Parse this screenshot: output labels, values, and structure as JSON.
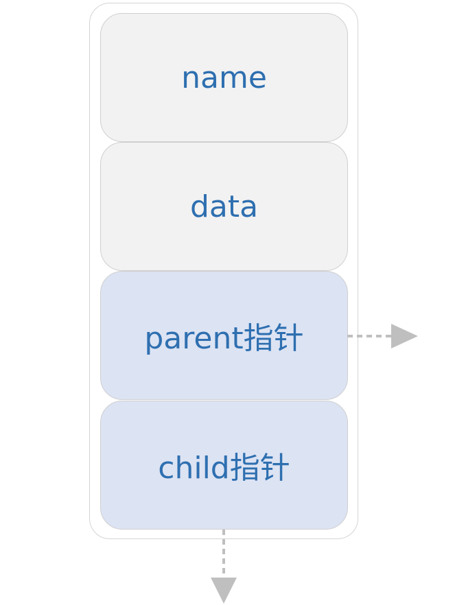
{
  "struct": {
    "fields": [
      {
        "id": "name",
        "label": "name",
        "style": "plain"
      },
      {
        "id": "data",
        "label": "data",
        "style": "plain"
      },
      {
        "id": "parent",
        "label": "parent指针",
        "style": "pointer"
      },
      {
        "id": "child",
        "label": "child指针",
        "style": "pointer"
      }
    ]
  },
  "arrows": [
    {
      "from": "parent",
      "direction": "right",
      "style": "dashed"
    },
    {
      "from": "child",
      "direction": "down",
      "style": "dashed"
    }
  ],
  "colors": {
    "plain_fill": "#f2f2f2",
    "pointer_fill": "#dce3f3",
    "text": "#2e6fb0",
    "arrow": "#bfbfbf"
  }
}
